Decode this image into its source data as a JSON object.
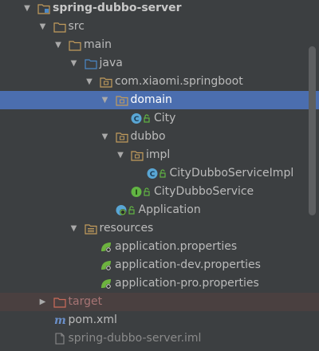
{
  "tree": {
    "items": [
      {
        "label": "spring-dubbo-server",
        "level": 0,
        "arrow": "expanded",
        "icon": "module-folder-icon",
        "bold": true
      },
      {
        "label": "src",
        "level": 1,
        "arrow": "expanded",
        "icon": "folder-icon"
      },
      {
        "label": "main",
        "level": 2,
        "arrow": "expanded",
        "icon": "folder-icon"
      },
      {
        "label": "java",
        "level": 3,
        "arrow": "expanded",
        "icon": "source-folder-icon"
      },
      {
        "label": "com.xiaomi.springboot",
        "level": 4,
        "arrow": "expanded",
        "icon": "package-icon"
      },
      {
        "label": "domain",
        "level": 5,
        "arrow": "expanded",
        "icon": "package-icon",
        "selected": true
      },
      {
        "label": "City",
        "level": 6,
        "arrow": "none",
        "icon": "class-icon"
      },
      {
        "label": "dubbo",
        "level": 5,
        "arrow": "expanded",
        "icon": "package-icon"
      },
      {
        "label": "impl",
        "level": 6,
        "arrow": "expanded",
        "icon": "package-icon"
      },
      {
        "label": "CityDubboServiceImpl",
        "level": 7,
        "arrow": "none",
        "icon": "class-icon"
      },
      {
        "label": "CityDubboService",
        "level": 6,
        "arrow": "none",
        "icon": "interface-icon"
      },
      {
        "label": "Application",
        "level": 5,
        "arrow": "none",
        "icon": "spring-boot-class-icon"
      },
      {
        "label": "resources",
        "level": 3,
        "arrow": "expanded",
        "icon": "resources-folder-icon"
      },
      {
        "label": "application.properties",
        "level": 4,
        "arrow": "none",
        "icon": "properties-file-icon"
      },
      {
        "label": "application-dev.properties",
        "level": 4,
        "arrow": "none",
        "icon": "properties-file-icon"
      },
      {
        "label": "application-pro.properties",
        "level": 4,
        "arrow": "none",
        "icon": "properties-file-icon"
      },
      {
        "label": "target",
        "level": 1,
        "arrow": "collapsed",
        "icon": "excluded-folder-icon",
        "excluded": true
      },
      {
        "label": "pom.xml",
        "level": 1,
        "arrow": "none",
        "icon": "maven-pom-icon"
      },
      {
        "label": "spring-dubbo-server.iml",
        "level": 1,
        "arrow": "none",
        "icon": "iml-file-icon",
        "dim": true
      }
    ]
  },
  "colors": {
    "background": "#3c3f41",
    "selection": "#4b6eaf",
    "folder": "#c29c5c",
    "class": "#59a6d4",
    "interface": "#62b543",
    "spring": "#6db33f",
    "excluded": "#cc6b5a"
  }
}
